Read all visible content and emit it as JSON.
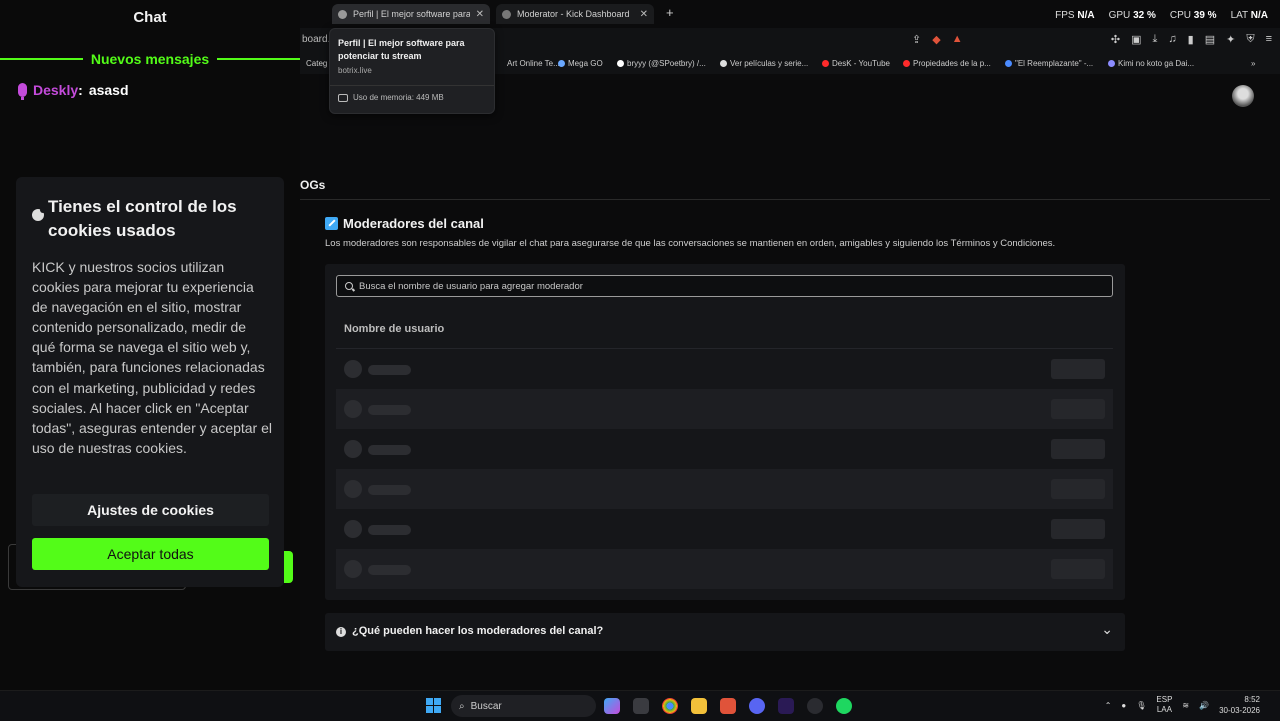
{
  "chat": {
    "title": "Chat",
    "new_messages": "Nuevos mensajes",
    "message": {
      "user": "Deskly",
      "separator": ":",
      "text": "asasd"
    }
  },
  "cookies": {
    "title": "Tienes el control de los cookies usados",
    "body": "KICK y nuestros socios utilizan cookies para mejorar tu experiencia de navegación en el sitio, mostrar contenido personalizado, medir de qué forma se navega el sitio web y, también, para funciones relacionadas con el marketing, publicidad y redes sociales. Al hacer click en \"Aceptar todas\", aseguras entender y aceptar el uso de nuestras cookies.",
    "settings_label": "Ajustes de cookies",
    "accept_label": "Aceptar todas",
    "accent": "#53fc18"
  },
  "browser": {
    "tabs": [
      {
        "label": "Perfil | El mejor software para po",
        "icon": "botrix-icon"
      },
      {
        "label": "Moderator - Kick Dashboard",
        "icon": "kick-icon"
      }
    ],
    "address": "board.",
    "stats": {
      "fps_label": "FPS",
      "fps": "N/A",
      "gpu_label": "GPU",
      "gpu": "32 %",
      "cpu_label": "CPU",
      "cpu": "39 %",
      "lat_label": "LAT",
      "lat": "N/A"
    },
    "bookmarks": [
      "Categ",
      "Art Online Te...",
      "Mega GO",
      "bryyy (@SPoetbry) /...",
      "Ver películas y serie...",
      "DesK - YouTube",
      "Propiedades de la p...",
      "\"El Reemplazante\" -...",
      "Kimi no koto ga Dai..."
    ],
    "tooltip": {
      "title": "Perfil | El mejor software para potenciar tu stream",
      "url": "botrix.live",
      "memory": "Uso de memoria: 449 MB"
    }
  },
  "main": {
    "section_label": "OGs",
    "title": "Moderadores del canal",
    "description": "Los moderadores son responsables de vigilar el chat para asegurarse de que las conversaciones se mantienen en orden, amigables y siguiendo los Términos y Condiciones.",
    "search_placeholder": "Busca el nombre de usuario para agregar moderador",
    "column_username": "Nombre de usuario",
    "faq": "¿Qué pueden hacer los moderadores del canal?"
  },
  "taskbar": {
    "search_label": "Buscar",
    "lang_top": "ESP",
    "lang_bottom": "LAA",
    "time": "8:52",
    "date": "30-03-2026"
  }
}
